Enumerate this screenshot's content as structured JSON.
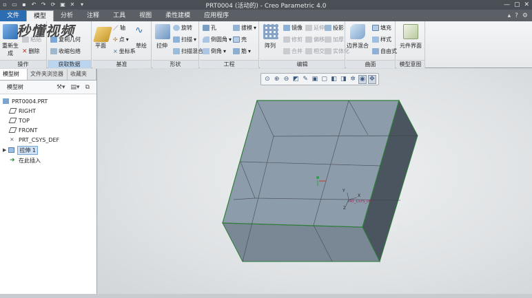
{
  "window": {
    "title": "PRT0004 (活动的) - Creo Parametric 4.0"
  },
  "watermark": "秒懂视频",
  "tabs": [
    "文件",
    "模型",
    "分析",
    "注释",
    "工具",
    "视图",
    "柔性建模",
    "应用程序"
  ],
  "active_tab": "模型",
  "ribbon": {
    "operations": {
      "items": [
        "重新生成",
        "粘贴",
        "删除"
      ],
      "caption": "操作"
    },
    "get_data": {
      "items": [
        "复制几何",
        "收缩包络"
      ],
      "caption": "获取数据"
    },
    "datum": {
      "items": [
        "平面",
        "轴",
        "点",
        "坐标系",
        "草绘"
      ],
      "caption": "基准"
    },
    "shapes": {
      "items": [
        "拉伸",
        "旋转",
        "扫描",
        "扫描混合"
      ],
      "caption": "形状"
    },
    "engineering": {
      "items": [
        "孔",
        "倒圆角",
        "倒角",
        "拔模",
        "壳",
        "筋"
      ],
      "caption": "工程"
    },
    "editing": {
      "items": [
        "阵列",
        "镜像",
        "修剪",
        "合并",
        "延伸",
        "偏移",
        "相交",
        "投影",
        "加厚",
        "实体化"
      ],
      "caption": "编辑"
    },
    "surfaces": {
      "items": [
        "边界混合",
        "填充",
        "样式",
        "自由式"
      ],
      "caption": "曲面"
    },
    "model_intent": {
      "items": [
        "元件界面"
      ],
      "caption": "模型意图"
    }
  },
  "left_panel": {
    "tabs": [
      "模型树",
      "文件夹浏览器",
      "收藏夹"
    ],
    "header": "模型树",
    "tree": [
      {
        "label": "PRT0004.PRT",
        "icon": "part-icon"
      },
      {
        "label": "RIGHT",
        "icon": "datum-plane-icon"
      },
      {
        "label": "TOP",
        "icon": "datum-plane-icon"
      },
      {
        "label": "FRONT",
        "icon": "datum-plane-icon"
      },
      {
        "label": "PRT_CSYS_DEF",
        "icon": "csys-icon"
      },
      {
        "label": "拉伸 1",
        "icon": "extrude-icon"
      },
      {
        "label": "在此插入",
        "icon": "insert-arrow-icon"
      }
    ]
  },
  "graphics": {
    "csys_label": "PRT_CSYS_DEF",
    "axis_labels": {
      "x": "X",
      "y": "Y",
      "z": "Z"
    }
  }
}
